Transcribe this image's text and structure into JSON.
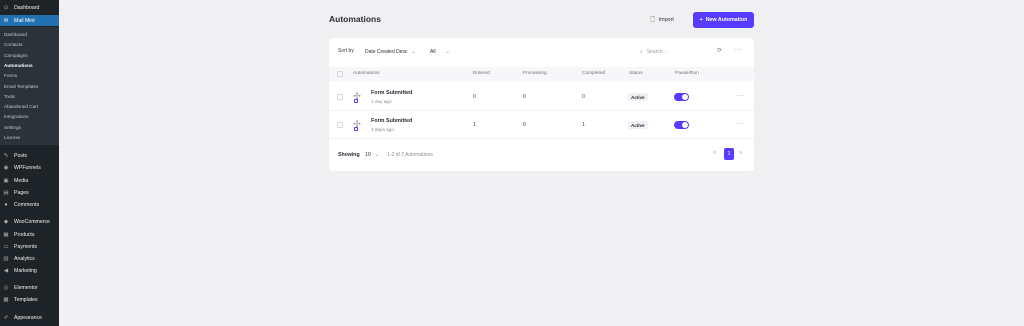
{
  "sidebar": {
    "top": [
      {
        "icon": "dashboard-icon",
        "glyph": "⊙",
        "label": "Dashboard"
      },
      {
        "icon": "mail-icon",
        "glyph": "✉",
        "label": "Mail Mint"
      }
    ],
    "submenu": [
      "Dashboard",
      "Contacts",
      "Campaigns",
      "Automations",
      "Forms",
      "Email Templates",
      "Tools",
      "Abandoned Cart",
      "Integrations",
      "Settings",
      "License"
    ],
    "bottom": [
      {
        "icon": "pin-icon",
        "glyph": "✎",
        "label": "Posts"
      },
      {
        "icon": "funnel-icon",
        "glyph": "◉",
        "label": "WPFunnels"
      },
      {
        "icon": "media-icon",
        "glyph": "▣",
        "label": "Media"
      },
      {
        "icon": "pages-icon",
        "glyph": "▤",
        "label": "Pages"
      },
      {
        "icon": "comments-icon",
        "glyph": "●",
        "label": "Comments"
      },
      {
        "icon": "woocommerce-icon",
        "glyph": "◆",
        "label": "WooCommerce"
      },
      {
        "icon": "products-icon",
        "glyph": "▦",
        "label": "Products"
      },
      {
        "icon": "payments-icon",
        "glyph": "▭",
        "label": "Payments"
      },
      {
        "icon": "analytics-icon",
        "glyph": "▥",
        "label": "Analytics"
      },
      {
        "icon": "marketing-icon",
        "glyph": "◀",
        "label": "Marketing"
      },
      {
        "icon": "elementor-icon",
        "glyph": "◎",
        "label": "Elementor"
      },
      {
        "icon": "templates-icon",
        "glyph": "▩",
        "label": "Templates"
      },
      {
        "icon": "appearance-icon",
        "glyph": "✐",
        "label": "Appearance"
      }
    ]
  },
  "header": {
    "title": "Automations",
    "import_label": "Import",
    "new_label": "New Automation"
  },
  "filters": {
    "sort_label": "Sort by",
    "sort_value": "Date Created Desc",
    "status_value": "All",
    "search_placeholder": "Search..."
  },
  "table": {
    "columns": [
      "Automations",
      "Entered",
      "Processing",
      "Completed",
      "Status",
      "Pause/Run"
    ],
    "rows": [
      {
        "name": "Form Submitted",
        "time": "1 day ago",
        "entered": "0",
        "processing": "0",
        "completed": "0",
        "status": "Active",
        "running": true
      },
      {
        "name": "Form Submitted",
        "time": "3 days ago",
        "entered": "1",
        "processing": "0",
        "completed": "1",
        "status": "Active",
        "running": true
      }
    ]
  },
  "footer": {
    "showing_label": "Showing",
    "per_page": "10",
    "range_text": "1-2 of 2 Automations",
    "current_page": "1"
  },
  "colors": {
    "accent": "#573bff",
    "sidebar_bg": "#1d2327",
    "sidebar_active": "#2271b1"
  }
}
